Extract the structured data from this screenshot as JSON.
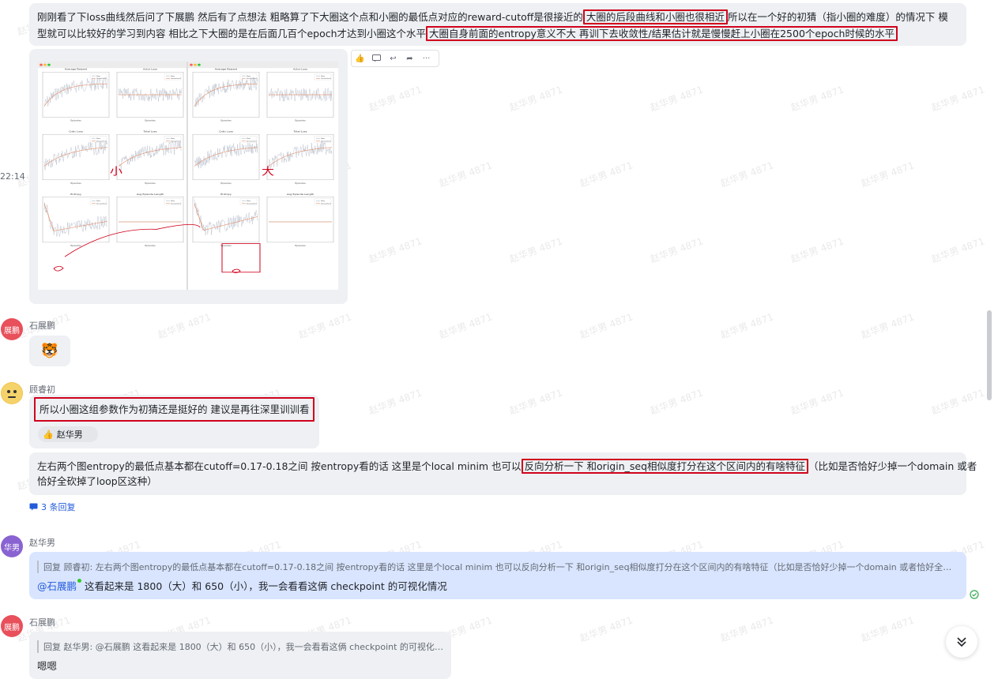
{
  "left_gutter": {
    "time": "22:14"
  },
  "watermark": "赵华男 4871",
  "messages": {
    "m1": {
      "line1_a": "刚刚看了下loss曲线然后问了下展鹏 然后有了点想法 粗略算了下大圈这个点和小圈的最低点对应的reward-cutoff是很接近的",
      "line1_hl": "大圈的后段曲线和小圈也很相近",
      "line1_b": "所以在一个好的初猜（指小圈的难度）的情况下  模",
      "line2_a": "型就可以比较好的学习到内容 相比之下大圈的是在后面几百个epoch才达到小圈这个水平",
      "line2_hl": "大圈自身前面的entropy意义不大 再训下去收敛性/结果估计就是慢慢赶上小圈在2500个epoch时候的水平"
    },
    "image_annotations": {
      "small_label": "小",
      "big_label": "大"
    },
    "plot_titles": {
      "avg_reward": "Average Reward",
      "actor_loss": "Actor Loss",
      "critic_loss": "Critic Loss",
      "total_loss": "Total Loss",
      "entropy": "Entropy",
      "avg_episode_length": "Avg Episode Length",
      "episodes": "Episodes",
      "raw": "Raw",
      "smoothed": "Smoothed"
    },
    "m2": {
      "sender": "石展鹏",
      "avatar": "展鹏",
      "sticker": "🐯"
    },
    "m3": {
      "sender": "顾睿初",
      "text": "所以小圈这组参数作为初猜还是挺好的 建议是再往深里训训看",
      "reaction_user": "赵华男"
    },
    "m4": {
      "line1_a": "左右两个图entropy的最低点基本都在cutoff=0.17-0.18之间 按entropy看的话 这里是个local minim 也可以",
      "line1_hl": "反向分析一下 和origin_seq相似度打分在这个区间内的有啥特征",
      "line1_b": "（比如是否恰好少掉一个domain 或者",
      "line2": "恰好全砍掉了loop区这种）",
      "replies": "3 条回复"
    },
    "m5": {
      "sender": "赵华男",
      "avatar": "华男",
      "quote": "回复 顾睿初:  左右两个图entropy的最低点基本都在cutoff=0.17-0.18之间 按entropy看的话 这里是个local minim 也可以反向分析一下 和origin_seq相似度打分在这个区间内的有啥特征（比如是否恰好少掉一个domain 或者恰好全砍掉了loop...",
      "mention": "@石展鹏",
      "text": " 这看起来是 1800（大）和 650（小），我一会看看这俩 checkpoint 的可视化情况"
    },
    "m6": {
      "sender": "石展鹏",
      "avatar": "展鹏",
      "quote": "回复 赵华男: @石展鹏 这看起来是 1800（大）和 650（小），我一会看看这俩 checkpoint 的可视化情况",
      "text": "嗯嗯"
    }
  },
  "colors": {
    "highlight": "#d0021b",
    "bubble": "#eef0f3",
    "link": "#245bdb",
    "reply_bubble": "#d9e5ff"
  }
}
